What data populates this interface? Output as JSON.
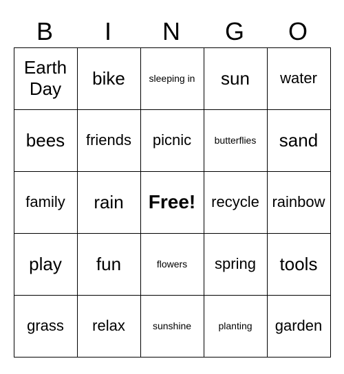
{
  "header": {
    "letters": [
      "B",
      "I",
      "N",
      "G",
      "O"
    ]
  },
  "grid": [
    [
      {
        "text": "Earth Day",
        "size": "earth-day"
      },
      {
        "text": "bike",
        "size": "large"
      },
      {
        "text": "sleeping in",
        "size": "small"
      },
      {
        "text": "sun",
        "size": "large"
      },
      {
        "text": "water",
        "size": "medium"
      }
    ],
    [
      {
        "text": "bees",
        "size": "large"
      },
      {
        "text": "friends",
        "size": "medium"
      },
      {
        "text": "picnic",
        "size": "medium"
      },
      {
        "text": "butterflies",
        "size": "small"
      },
      {
        "text": "sand",
        "size": "large"
      }
    ],
    [
      {
        "text": "family",
        "size": "medium"
      },
      {
        "text": "rain",
        "size": "large"
      },
      {
        "text": "Free!",
        "size": "free"
      },
      {
        "text": "recycle",
        "size": "medium"
      },
      {
        "text": "rainbow",
        "size": "medium"
      }
    ],
    [
      {
        "text": "play",
        "size": "large"
      },
      {
        "text": "fun",
        "size": "large"
      },
      {
        "text": "flowers",
        "size": "small"
      },
      {
        "text": "spring",
        "size": "medium"
      },
      {
        "text": "tools",
        "size": "large"
      }
    ],
    [
      {
        "text": "grass",
        "size": "medium"
      },
      {
        "text": "relax",
        "size": "medium"
      },
      {
        "text": "sunshine",
        "size": "small"
      },
      {
        "text": "planting",
        "size": "small"
      },
      {
        "text": "garden",
        "size": "medium"
      }
    ]
  ]
}
